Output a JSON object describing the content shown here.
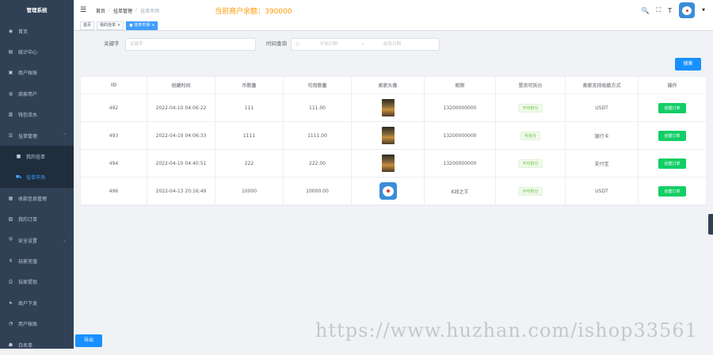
{
  "sidebar": {
    "title": "管理系统",
    "items": [
      {
        "label": "首页",
        "icon": "dashboard-icon"
      },
      {
        "label": "统计中心",
        "icon": "chart-icon"
      },
      {
        "label": "商户账账",
        "icon": "account-icon"
      },
      {
        "label": "商家用户",
        "icon": "user-icon"
      },
      {
        "label": "钱包流水",
        "icon": "wallet-icon"
      },
      {
        "label": "挂单管理",
        "icon": "list-icon",
        "expanded": true
      },
      {
        "label": "我的挂单",
        "icon": "file-icon",
        "sub": true
      },
      {
        "label": "挂单市场",
        "icon": "cart-icon",
        "sub": true,
        "active": true
      },
      {
        "label": "收款信息管理",
        "icon": "card-icon"
      },
      {
        "label": "我的订单",
        "icon": "order-icon"
      },
      {
        "label": "安全设置",
        "icon": "lock-icon",
        "expandable": true
      },
      {
        "label": "玩家充值",
        "icon": "yen-icon"
      },
      {
        "label": "玩家提现",
        "icon": "withdraw-icon"
      },
      {
        "label": "商户下发",
        "icon": "send-icon"
      },
      {
        "label": "用户账账",
        "icon": "ledger-icon"
      },
      {
        "label": "白名单",
        "icon": "whitelist-icon"
      }
    ]
  },
  "header": {
    "breadcrumb": [
      "首页",
      "挂单管理",
      "挂单市场"
    ],
    "balance": "当前商户余额：390000"
  },
  "tags": [
    {
      "label": "首页",
      "active": false
    },
    {
      "label": "我的挂单",
      "active": false,
      "closable": true
    },
    {
      "label": "挂单市场",
      "active": true,
      "closable": true
    }
  ],
  "filters": {
    "keyword_label": "关键字",
    "keyword_placeholder": "关键字",
    "time_label": "时间查询",
    "start_placeholder": "开始日期",
    "range_sep": "-",
    "end_placeholder": "结束日期",
    "search_button": "搜索"
  },
  "table": {
    "columns": [
      "ID",
      "创建时间",
      "币数量",
      "可用数量",
      "卖家头像",
      "昵称",
      "是否可拆分",
      "卖家支持收款方式",
      "操作"
    ],
    "rows": [
      {
        "id": "492",
        "created": "2022-04-10 04:06:22",
        "amount": "111",
        "available": "111.00",
        "avatar": "photo",
        "nickname": "13200000000",
        "split": "不可拆分",
        "payment": "USDT",
        "action": "创建订单"
      },
      {
        "id": "493",
        "created": "2022-04-10 04:06:33",
        "amount": "1111",
        "available": "1111.00",
        "avatar": "photo",
        "nickname": "13200000000",
        "split": "可拆分",
        "payment": "银行卡",
        "action": "创建订单"
      },
      {
        "id": "494",
        "created": "2022-04-10 04:40:51",
        "amount": "222",
        "available": "222.00",
        "avatar": "photo",
        "nickname": "13200000000",
        "split": "不可拆分",
        "payment": "支付宝",
        "action": "创建订单"
      },
      {
        "id": "496",
        "created": "2022-04-13 20:16:49",
        "amount": "10000",
        "available": "10000.00",
        "avatar": "cartoon",
        "nickname": "K线之王",
        "split": "不可拆分",
        "payment": "USDT",
        "action": "创建订单"
      }
    ]
  },
  "export_button": "导出",
  "watermark": "https://www.huzhan.com/ishop33561",
  "colors": {
    "sidebar": "#304156",
    "accent": "#1890ff",
    "success": "#13ce66",
    "balance": "#ff9900"
  }
}
